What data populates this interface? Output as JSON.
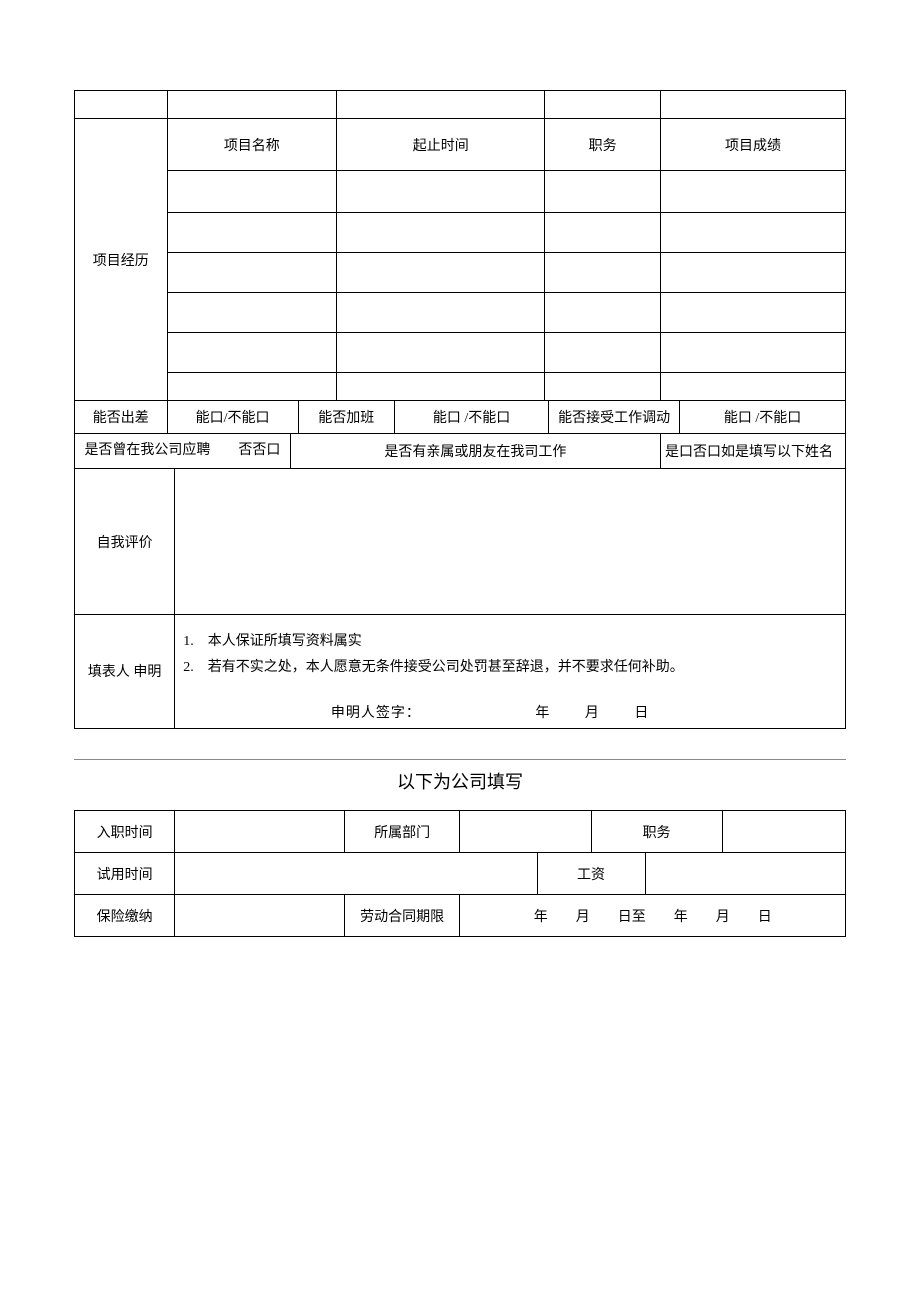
{
  "project": {
    "section_label": "项目经历",
    "headers": {
      "name": "项目名称",
      "period": "起止时间",
      "position": "职务",
      "result": "项目成绩"
    }
  },
  "avail": {
    "travel_label": "能否出差",
    "travel_value": "能口/不能口",
    "overtime_label": "能否加班",
    "overtime_value": "能口 /不能口",
    "transfer_label": "能否接受工作调动",
    "transfer_value": "能口 /不能口"
  },
  "history": {
    "applied_before": "是否曾在我公司应聘　　否否口",
    "relatives_label": "是否有亲属或朋友在我司工作",
    "relatives_value": "是口否口如是填写以下姓名"
  },
  "self_eval_label": "自我评价",
  "declaration": {
    "section_label": "填表人 申明",
    "line1": "1. 本人保证所填写资料属实",
    "line2": "2. 若有不实之处，本人愿意无条件接受公司处罚甚至辞退，并不要求任何补助。",
    "sign_label": "申明人签字：",
    "y": "年",
    "m": "月",
    "d": "日"
  },
  "company": {
    "title": "以下为公司填写",
    "onboard_label": "入职时间",
    "dept_label": "所属部门",
    "position_label": "职务",
    "probation_label": "试用时间",
    "salary_label": "工资",
    "insurance_label": "保险缴纳",
    "contract_label": "劳动合同期限",
    "contract_value": "年　　月　　日至　　年　　月　　日"
  }
}
